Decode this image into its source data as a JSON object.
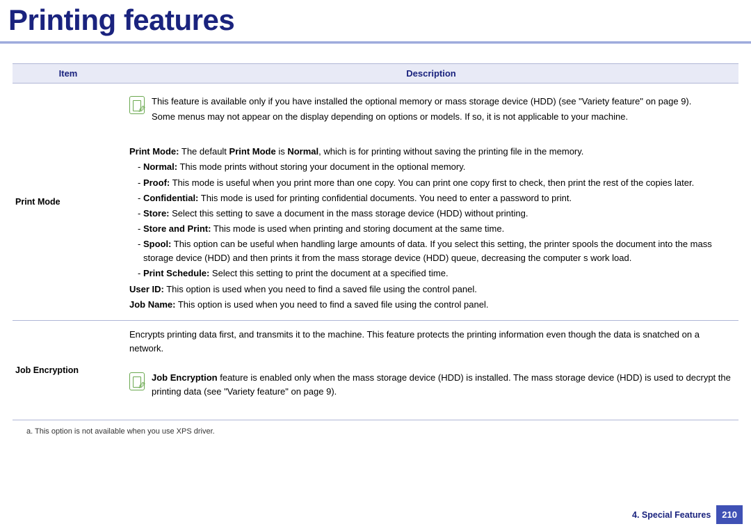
{
  "title": "Printing features",
  "table": {
    "header_item": "Item",
    "header_desc": "Description"
  },
  "row1": {
    "item": "Print Mode",
    "note_line1": "This feature is available only if you have installed the optional memory or mass storage device (HDD) (see \"Variety feature\" on page 9).",
    "note_line2": "Some menus may not appear on the display depending on options or models. If so, it is not applicable to your machine.",
    "pm_label": "Print Mode:",
    "pm_text1": " The default ",
    "pm_bold2": "Print Mode",
    "pm_text2": " is ",
    "pm_bold3": "Normal",
    "pm_text3": ", which is for printing without saving the printing file in the memory.",
    "b_normal": "Normal:",
    "t_normal": " This mode prints without storing your document in the optional memory.",
    "b_proof": "Proof:",
    "t_proof": " This mode is useful when you print more than one copy. You can print one copy first to check, then print the rest of the copies later.",
    "b_conf": "Confidential:",
    "t_conf": " This mode is used for printing confidential documents. You need to enter a password to print.",
    "b_store": "Store:",
    "t_store": " Select this setting to save a document in the mass storage device (HDD) without printing.",
    "b_sap": "Store and Print:",
    "t_sap": " This mode is used when printing and storing document at the same time.",
    "b_spool": "Spool:",
    "t_spool": " This option can be useful when handling large amounts of data. If you select this setting, the printer spools the document into the mass storage device (HDD) and then prints it from the mass storage device (HDD) queue, decreasing the computer s work load.",
    "b_sched": "Print Schedule:",
    "t_sched": " Select this setting to print the document at a specified time.",
    "b_uid": "User ID:",
    "t_uid": " This option is used when you need to find a saved file using the control panel.",
    "b_jn": "Job Name:",
    "t_jn": " This option is used when you need to find a saved file using the control panel."
  },
  "row2": {
    "item": "Job Encryption",
    "intro": "Encrypts printing data first, and transmits it to the machine. This feature protects the printing information even though the data is snatched on a network.",
    "note_b": "Job Encryption",
    "note_t": " feature is enabled only when the mass storage device (HDD) is installed. The mass storage device (HDD) is used to decrypt the printing data (see \"Variety feature\" on page 9)."
  },
  "footnote": "a.  This option is not available when you use XPS driver.",
  "footer": {
    "chapter": "4.  Special Features",
    "page": "210"
  }
}
